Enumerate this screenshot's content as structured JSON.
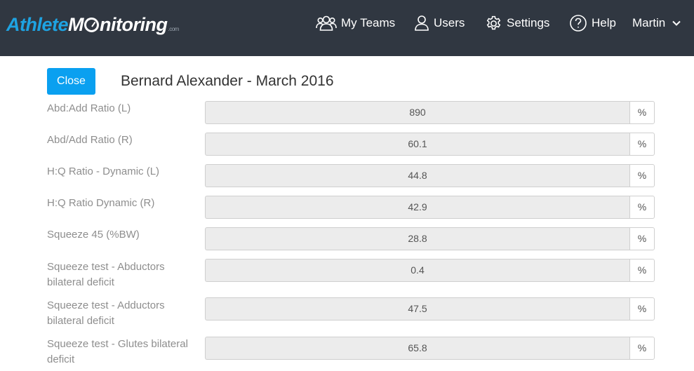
{
  "brand": {
    "logo_part1": "Athlete",
    "logo_part2": "M",
    "logo_part3": "nitoring",
    "logo_suffix": ".com",
    "accent_color": "#1ea3e2",
    "navbar_color": "#303741"
  },
  "nav": {
    "teams": {
      "label": "My Teams",
      "icon": "teams-icon"
    },
    "users": {
      "label": "Users",
      "icon": "user-icon"
    },
    "settings": {
      "label": "Settings",
      "icon": "gear-icon"
    },
    "help": {
      "label": "Help",
      "icon": "help-icon"
    },
    "account": {
      "label": "Martin",
      "icon": "chevron-down-icon"
    }
  },
  "header": {
    "close_label": "Close",
    "title": "Bernard Alexander - March 2016"
  },
  "rows": [
    {
      "label": "Abd:Add Ratio (L)",
      "value": "890",
      "unit": "%"
    },
    {
      "label": "Abd/Add Ratio (R)",
      "value": "60.1",
      "unit": "%"
    },
    {
      "label": "H:Q Ratio - Dynamic (L)",
      "value": "44.8",
      "unit": "%"
    },
    {
      "label": "H:Q Ratio Dynamic (R)",
      "value": "42.9",
      "unit": "%"
    },
    {
      "label": "Squeeze 45 (%BW)",
      "value": "28.8",
      "unit": "%"
    },
    {
      "label": "Squeeze test - Abductors bilateral deficit",
      "value": "0.4",
      "unit": "%"
    },
    {
      "label": "Squeeze test - Adductors bilateral deficit",
      "value": "47.5",
      "unit": "%"
    },
    {
      "label": "Squeeze test - Glutes bilateral deficit",
      "value": "65.8",
      "unit": "%"
    }
  ]
}
